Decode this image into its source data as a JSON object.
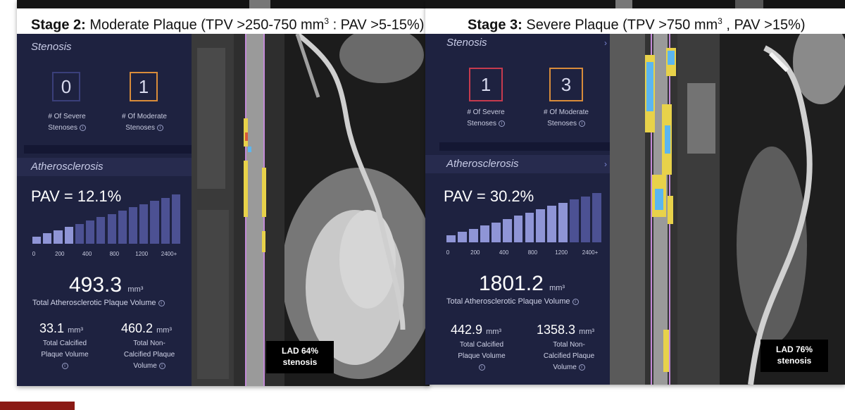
{
  "stage2": {
    "title_bold": "Stage 2:",
    "title_rest": "Moderate Plaque (TPV >250-750 mm",
    "title_sup1": "3",
    "title_mid": " : PAV >5-15%)",
    "stenosis_header": "Stenosis",
    "severe_count": "0",
    "severe_label_1": "# Of Severe",
    "severe_label_2": "Stenoses",
    "moderate_count": "1",
    "moderate_label_1": "# Of Moderate",
    "moderate_label_2": "Stenoses",
    "athero_header": "Atherosclerosis",
    "pav": "PAV = 12.1%",
    "scale_ticks": [
      "0",
      "200",
      "400",
      "800",
      "1200",
      "2400+"
    ],
    "scale_fill_fraction": 0.35,
    "total_value": "493.3",
    "total_unit": "mm³",
    "total_label": "Total Atherosclerotic Plaque Volume",
    "calcified_value": "33.1",
    "calcified_unit": "mm³",
    "calcified_label_1": "Total Calcified",
    "calcified_label_2": "Plaque Volume",
    "noncalcified_value": "460.2",
    "noncalcified_unit": "mm³",
    "noncalcified_label_1": "Total Non-",
    "noncalcified_label_2": "Calcified Plaque",
    "noncalcified_label_3": "Volume",
    "lad_line1": "LAD 64%",
    "lad_line2": "stenosis"
  },
  "stage3": {
    "title_bold": "Stage 3:",
    "title_rest": "Severe Plaque (TPV >750 mm",
    "title_sup1": "3",
    "title_mid": " , PAV >15%)",
    "stenosis_header": "Stenosis",
    "severe_count": "1",
    "severe_label_1": "# Of Severe",
    "severe_label_2": "Stenoses",
    "moderate_count": "3",
    "moderate_label_1": "# Of Moderate",
    "moderate_label_2": "Stenoses",
    "athero_header": "Atherosclerosis",
    "pav": "PAV = 30.2%",
    "scale_ticks": [
      "0",
      "200",
      "400",
      "800",
      "1200",
      "2400+"
    ],
    "scale_fill_fraction": 0.85,
    "total_value": "1801.2",
    "total_unit": "mm³",
    "total_label": "Total Atherosclerotic Plaque Volume",
    "calcified_value": "442.9",
    "calcified_unit": "mm³",
    "calcified_label_1": "Total Calcified",
    "calcified_label_2": "Plaque Volume",
    "noncalcified_value": "1358.3",
    "noncalcified_unit": "mm³",
    "noncalcified_label_1": "Total Non-",
    "noncalcified_label_2": "Calcified Plaque",
    "noncalcified_label_3": "Volume",
    "lad_line1": "LAD 76%",
    "lad_line2": "stenosis"
  },
  "colors": {
    "severe_box": "#c63a4e",
    "moderate_box": "#d98c3a",
    "empty_box": "#3a3f7a",
    "scale_bar": "#8f95d6",
    "scale_dim": "#4c5193",
    "plaque_yellow": "#e8d24a",
    "plaque_blue": "#5bb6f0",
    "lumen_pink": "#c38ad8"
  }
}
